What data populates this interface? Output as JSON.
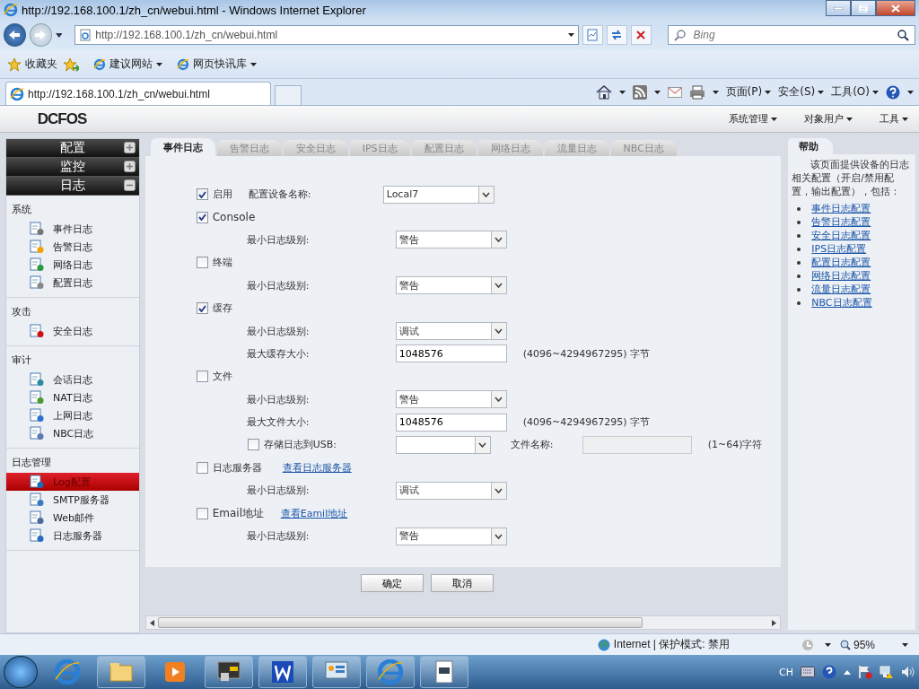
{
  "window": {
    "title": "http://192.168.100.1/zh_cn/webui.html - Windows Internet Explorer"
  },
  "address_bar": {
    "value": "http://192.168.100.1/zh_cn/webui.html"
  },
  "search": {
    "placeholder": "Bing"
  },
  "favorites_bar": {
    "label": "收藏夹",
    "links": [
      "建议网站",
      "网页快讯库"
    ]
  },
  "browser_tabs": [
    {
      "label": "http://192.168.100.1/zh_cn/webui.html",
      "selected": true
    }
  ],
  "command_bar": {
    "menus": [
      "页面(P)",
      "安全(S)",
      "工具(O)"
    ]
  },
  "app": {
    "logo": "DCFOS",
    "top_menu": [
      "系统管理",
      "对象用户",
      "工具"
    ]
  },
  "sidebar": {
    "sections": [
      {
        "label": "配置",
        "expanded": false
      },
      {
        "label": "监控",
        "expanded": false
      },
      {
        "label": "日志",
        "expanded": true
      }
    ],
    "groups": [
      {
        "title": "系统",
        "items": [
          {
            "label": "事件日志",
            "kind": "event",
            "selected": false
          },
          {
            "label": "告警日志",
            "kind": "alert",
            "selected": false
          },
          {
            "label": "网络日志",
            "kind": "network",
            "selected": false
          },
          {
            "label": "配置日志",
            "kind": "config",
            "selected": false
          }
        ]
      },
      {
        "title": "攻击",
        "items": [
          {
            "label": "安全日志",
            "kind": "security",
            "selected": false
          }
        ]
      },
      {
        "title": "审计",
        "items": [
          {
            "label": "会话日志",
            "kind": "session",
            "selected": false
          },
          {
            "label": "NAT日志",
            "kind": "nat",
            "selected": false
          },
          {
            "label": "上网日志",
            "kind": "web",
            "selected": false
          },
          {
            "label": "NBC日志",
            "kind": "nbc",
            "selected": false
          }
        ]
      },
      {
        "title": "日志管理",
        "items": [
          {
            "label": "Log配置",
            "kind": "log",
            "selected": true
          },
          {
            "label": "SMTP服务器",
            "kind": "smtp",
            "selected": false
          },
          {
            "label": "Web邮件",
            "kind": "mail",
            "selected": false
          },
          {
            "label": "日志服务器",
            "kind": "server",
            "selected": false
          }
        ]
      }
    ]
  },
  "tabs": [
    {
      "label": "事件日志",
      "selected": true
    },
    {
      "label": "告警日志",
      "selected": false
    },
    {
      "label": "安全日志",
      "selected": false
    },
    {
      "label": "IPS日志",
      "selected": false
    },
    {
      "label": "配置日志",
      "selected": false
    },
    {
      "label": "网络日志",
      "selected": false
    },
    {
      "label": "流量日志",
      "selected": false
    },
    {
      "label": "NBC日志",
      "selected": false
    }
  ],
  "form": [
    {
      "kind": "check",
      "label": "启用",
      "checked": true,
      "field_label": "配置设备名称:",
      "select": "Local7"
    },
    {
      "kind": "check",
      "label": "Console",
      "checked": true
    },
    {
      "kind": "select",
      "label": "最小日志级别:",
      "value": "警告"
    },
    {
      "kind": "check",
      "label": "终端",
      "checked": false
    },
    {
      "kind": "select",
      "label": "最小日志级别:",
      "value": "警告"
    },
    {
      "kind": "check",
      "label": "缓存",
      "checked": true
    },
    {
      "kind": "select",
      "label": "最小日志级别:",
      "value": "调试"
    },
    {
      "kind": "input",
      "label": "最大缓存大小:",
      "value": "1048576",
      "hint": "(4096~4294967295) 字节"
    },
    {
      "kind": "check",
      "label": "文件",
      "checked": false
    },
    {
      "kind": "select",
      "label": "最小日志级别:",
      "value": "警告"
    },
    {
      "kind": "input",
      "label": "最大文件大小:",
      "value": "1048576",
      "hint": "(4096~4294967295) 字节"
    },
    {
      "kind": "usb",
      "label": "存储日志到USB:",
      "checked": false,
      "field_label": "文件名称:",
      "hint": "(1~64)字符"
    },
    {
      "kind": "check",
      "label": "日志服务器",
      "checked": false,
      "link": "查看日志服务器"
    },
    {
      "kind": "select",
      "label": "最小日志级别:",
      "value": "调试"
    },
    {
      "kind": "check",
      "label": "Email地址",
      "checked": false,
      "link": "查看Eamil地址"
    },
    {
      "kind": "select",
      "label": "最小日志级别:",
      "value": "警告"
    }
  ],
  "buttons": [
    "确定",
    "取消"
  ],
  "help": {
    "title": "帮助",
    "text": "该页面提供设备的日志相关配置（开启/禁用配置，输出配置），包括：",
    "links": [
      "事件日志配置",
      "告警日志配置",
      "安全日志配置",
      "IPS日志配置",
      "配置日志配置",
      "网络日志配置",
      "流量日志配置",
      "NBC日志配置"
    ]
  },
  "status_bar": {
    "zone": "Internet | 保护模式: 禁用",
    "zoom": "95%"
  },
  "taskbar": {
    "ime": "CH"
  }
}
